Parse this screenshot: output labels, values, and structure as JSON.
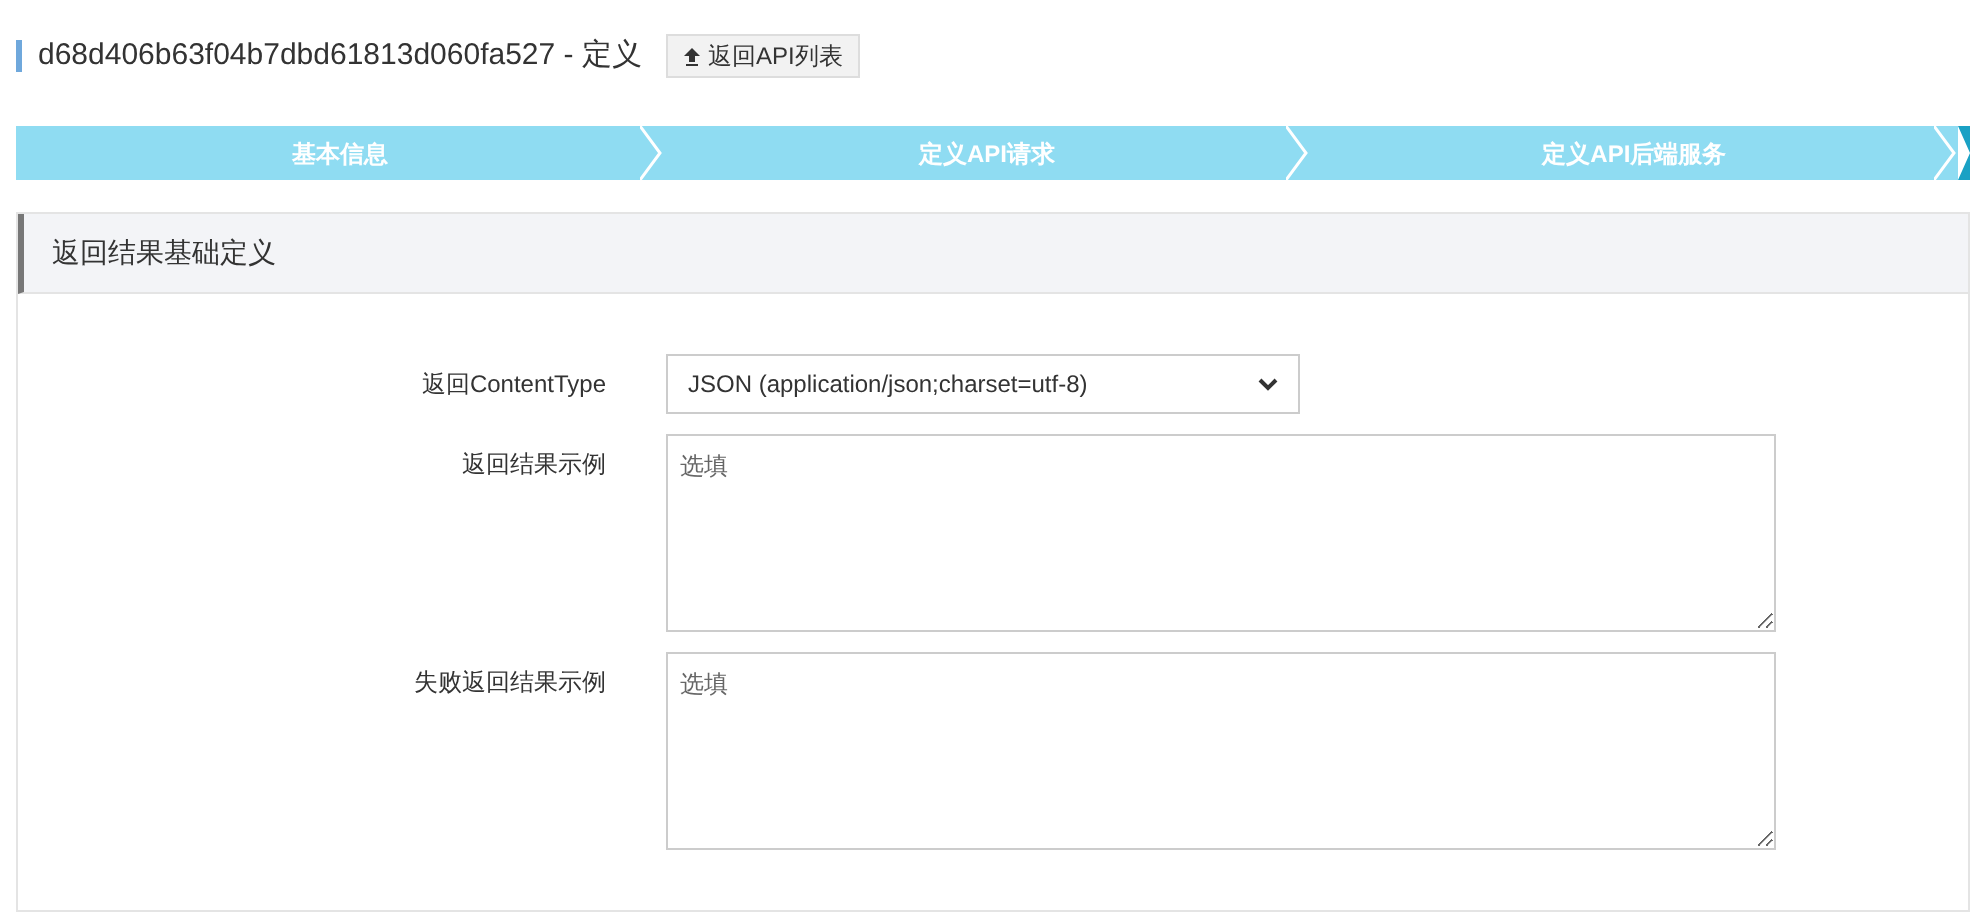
{
  "header": {
    "title": "d68d406b63f04b7dbd61813d060fa527 - 定义",
    "back_button": "返回API列表"
  },
  "steps": [
    {
      "label": "基本信息"
    },
    {
      "label": "定义API请求"
    },
    {
      "label": "定义API后端服务"
    }
  ],
  "section": {
    "title": "返回结果基础定义",
    "fields": [
      {
        "kind": "select",
        "label": "返回ContentType",
        "value": "JSON (application/json;charset=utf-8)"
      },
      {
        "kind": "textarea",
        "label": "返回结果示例",
        "placeholder": "选填"
      },
      {
        "kind": "textarea",
        "label": "失败返回结果示例",
        "placeholder": "选填"
      }
    ]
  }
}
